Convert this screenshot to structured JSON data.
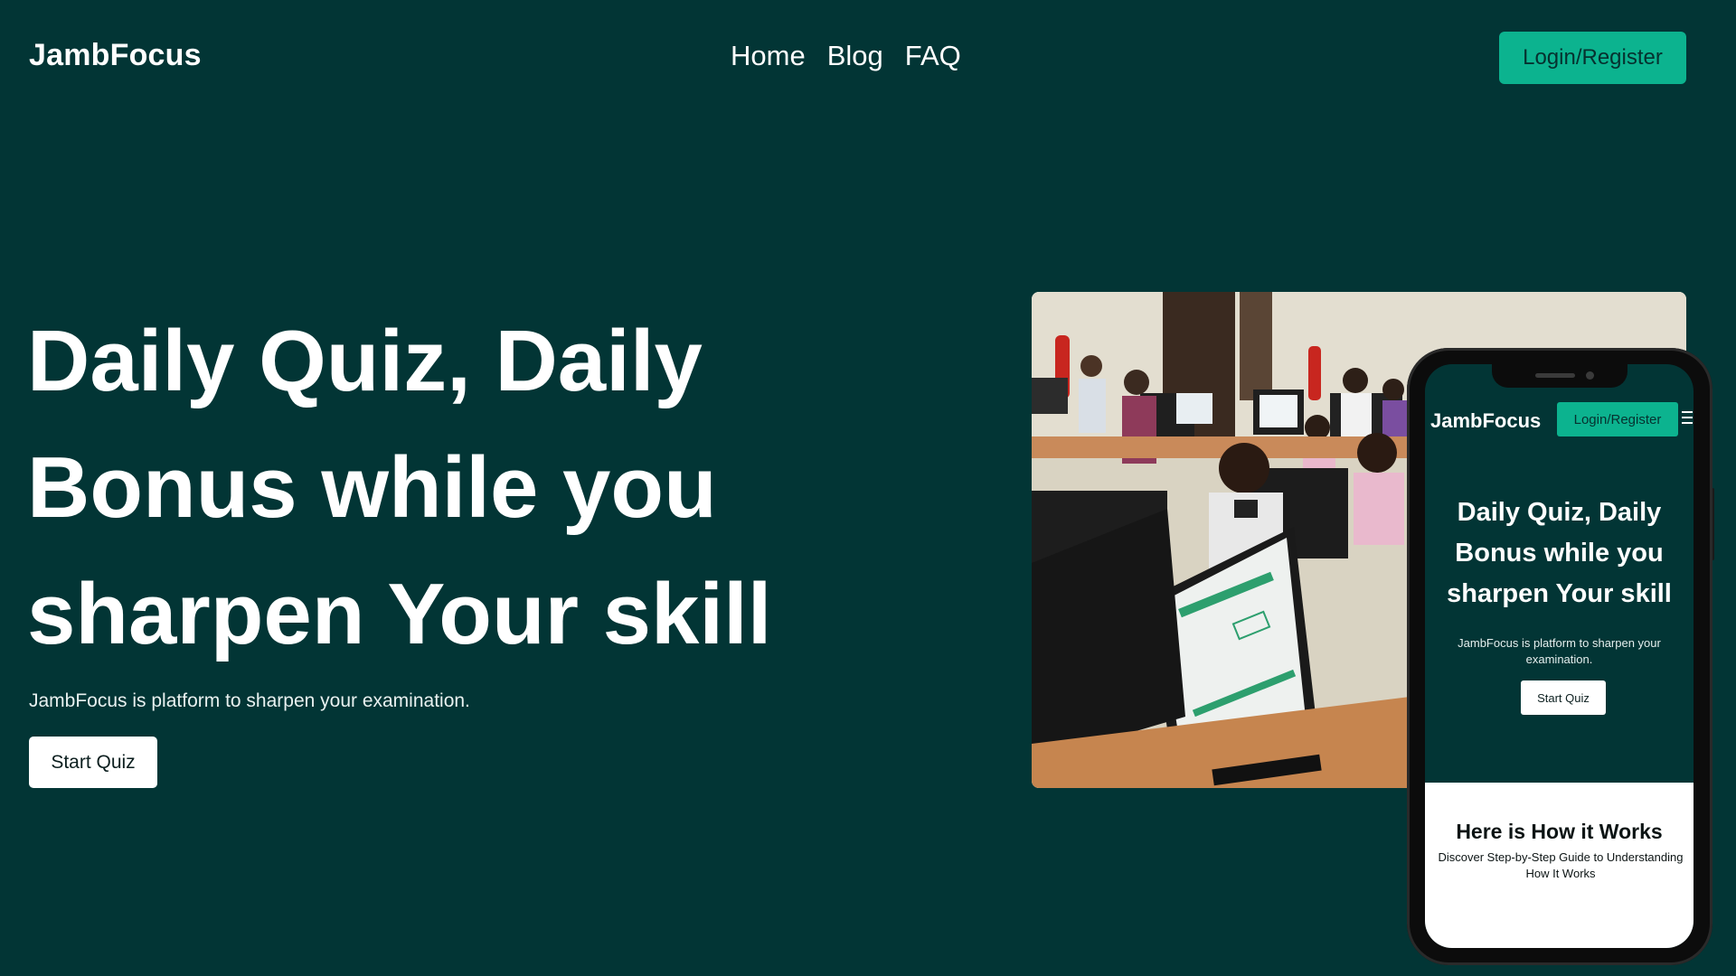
{
  "header": {
    "logo": "JambFocus",
    "nav": [
      "Home",
      "Blog",
      "FAQ"
    ],
    "login_label": "Login/Register"
  },
  "hero": {
    "title_lines": [
      "Daily Quiz, Daily",
      "Bonus while you",
      "sharpen Your skill"
    ],
    "subtitle": "JambFocus is platform to sharpen your examination.",
    "start_label": "Start Quiz"
  },
  "mobile_preview": {
    "logo": "JambFocus",
    "login_label": "Login/Register",
    "title_lines": [
      "Daily Quiz, Daily",
      "Bonus while you",
      "sharpen Your skill"
    ],
    "subtitle": "JambFocus is platform to sharpen your examination.",
    "start_label": "Start Quiz",
    "section_title": "Here is How it Works",
    "section_subtitle": "Discover Step-by-Step Guide to Understanding How It Works"
  },
  "colors": {
    "background": "#023535",
    "accent": "#0cb38f",
    "button_light": "#ffffff"
  }
}
